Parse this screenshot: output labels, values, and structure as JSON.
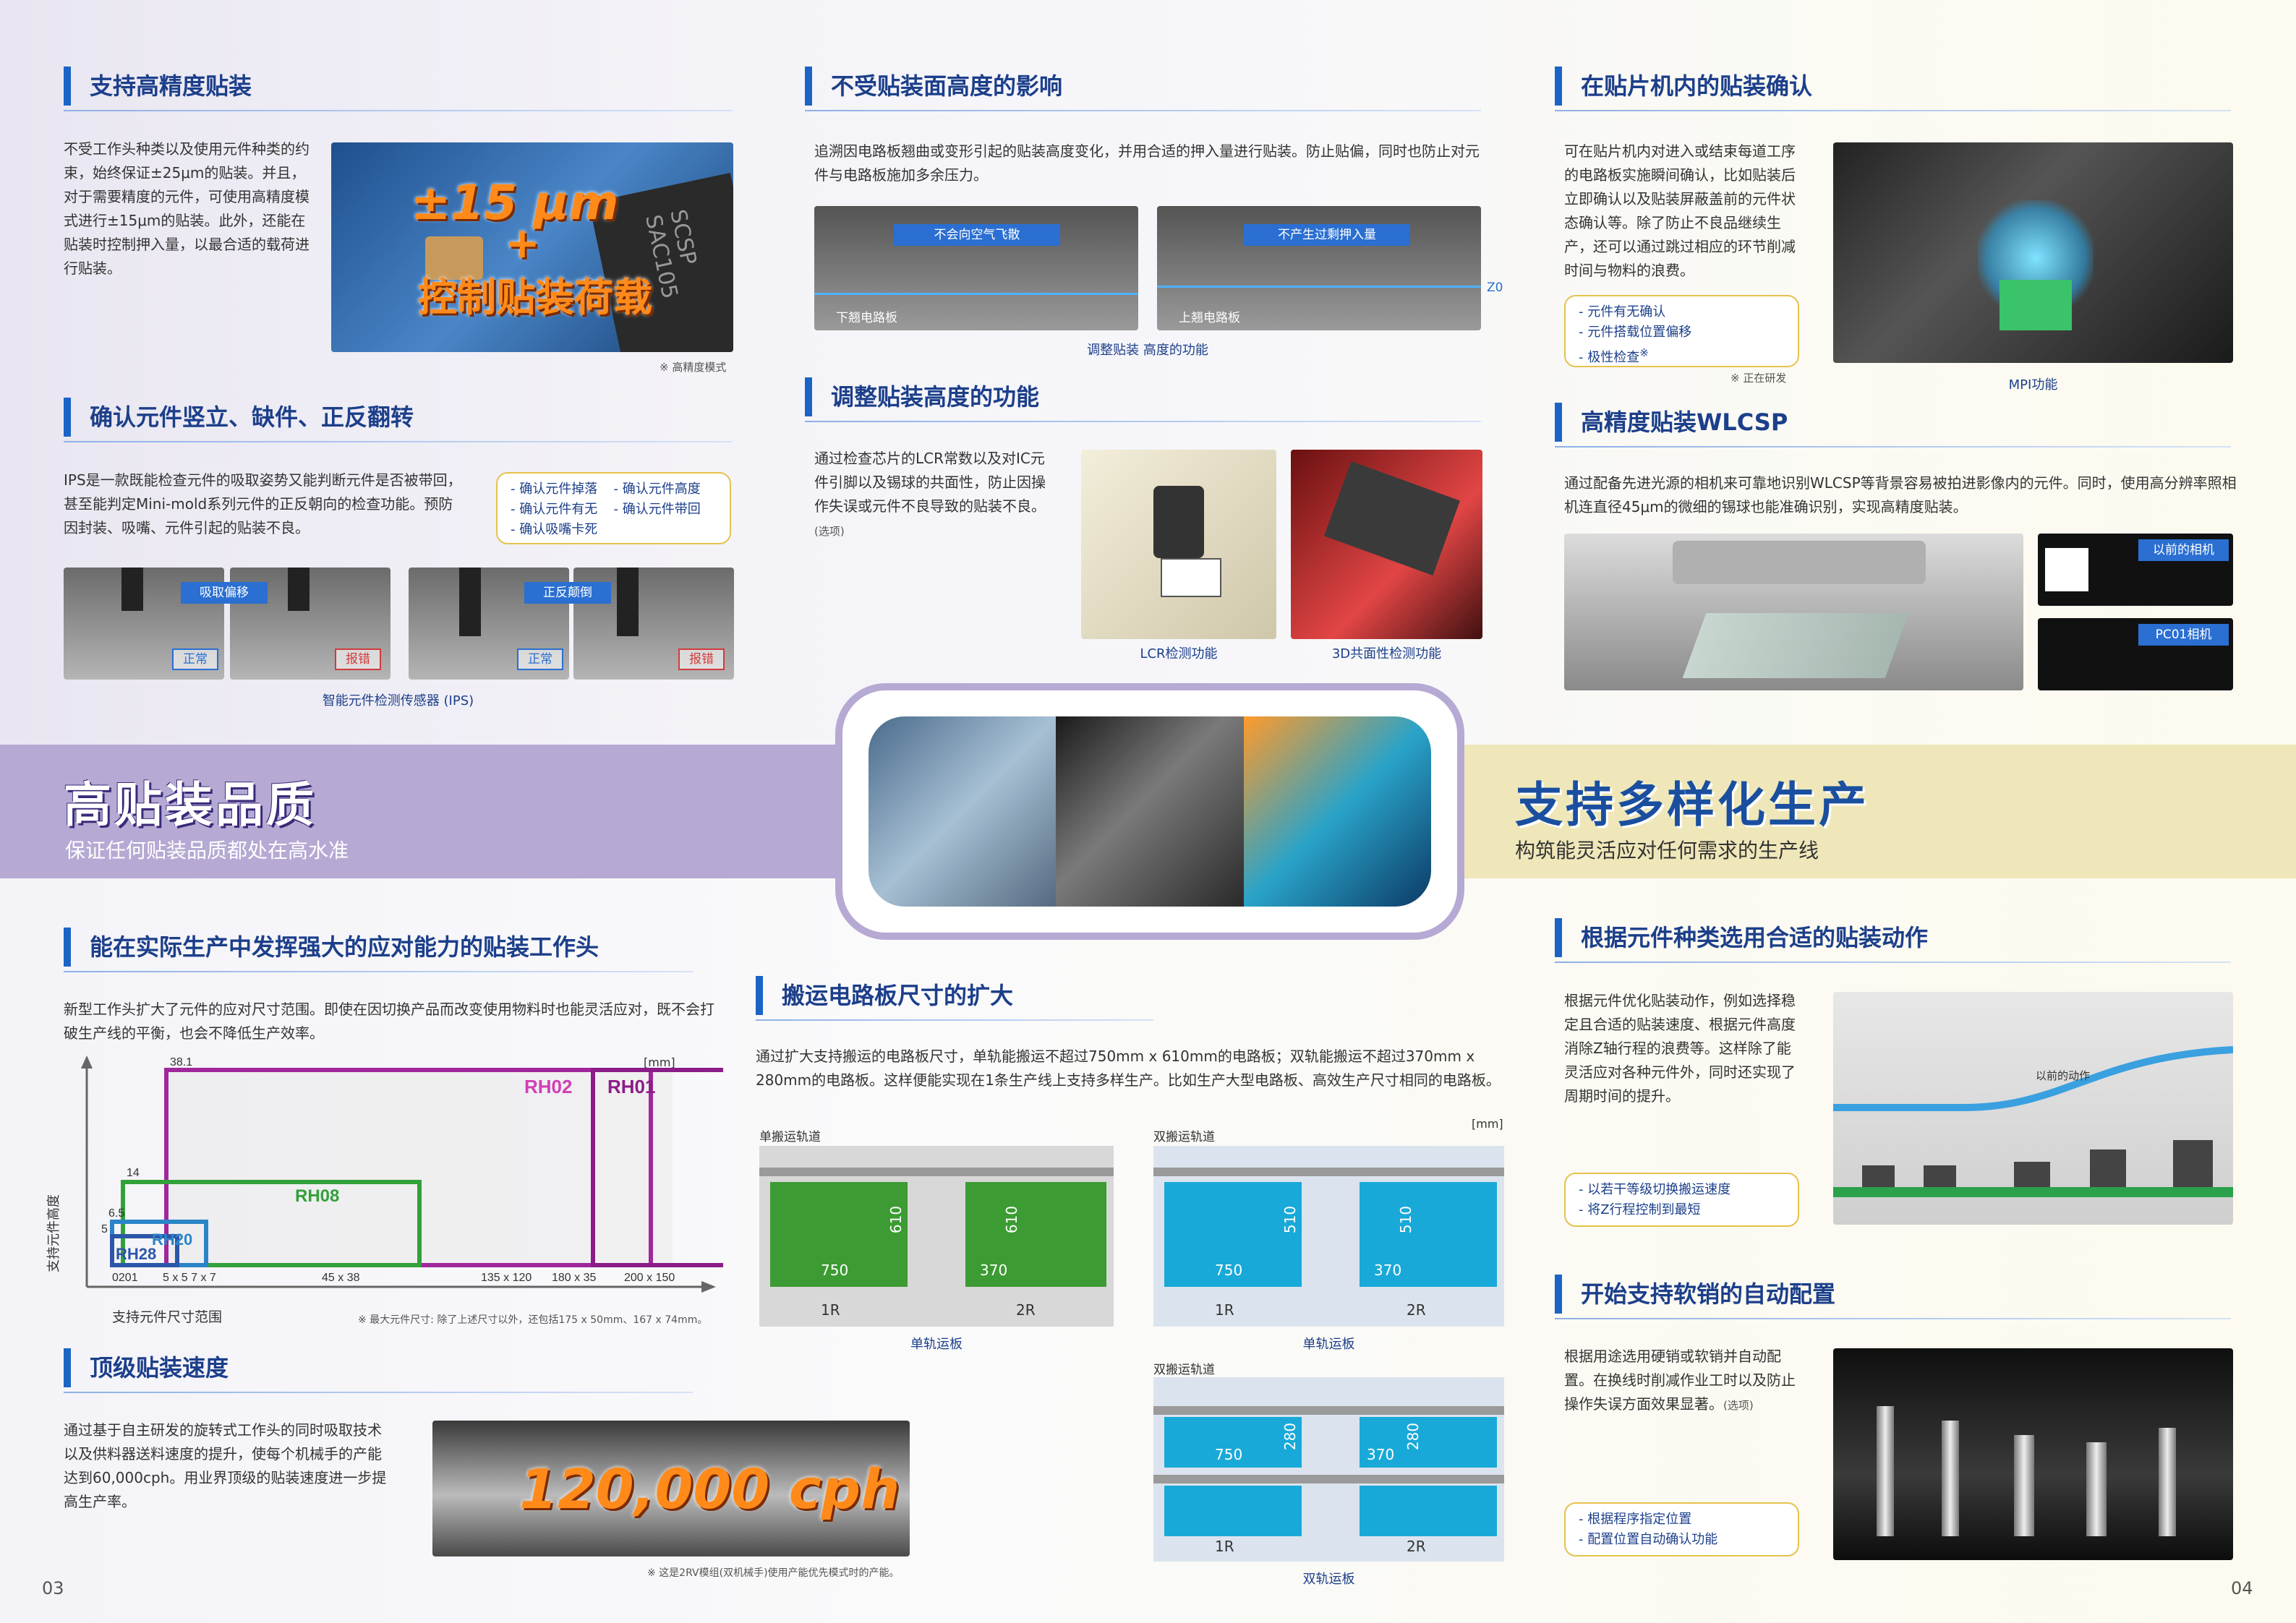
{
  "bands": {
    "left_title": "高贴装品质",
    "left_sub": "保证任何贴装品质都处在高水准",
    "right_title": "支持多样化生产",
    "right_sub": "构筑能灵活应对任何需求的生产线"
  },
  "s1": {
    "title": "支持高精度贴装",
    "body": "不受工作头种类以及使用元件种类的约束，始终保证±25μm的贴装。并且，对于需要精度的元件，可使用高精度模式进行±15μm的贴装。此外，还能在贴装时控制押入量，以最合适的载荷进行贴装。",
    "big1": "±15 μm",
    "plus": "+",
    "big2": "控制贴装荷载",
    "note": "※ 高精度模式",
    "chip_label": "SCSP SAC105"
  },
  "s2": {
    "title": "确认元件竖立、缺件、正反翻转",
    "body": "IPS是一款既能检查元件的吸取姿势又能判断元件是否被带回，甚至能判定Mini-mold系列元件的正反朝向的检查功能。预防因封装、吸嘴、元件引起的贴装不良。",
    "checks": [
      "- 确认元件掉落",
      "- 确认元件高度",
      "- 确认元件有无",
      "- 确认元件带回",
      "- 确认吸嘴卡死"
    ],
    "tag1": "吸取偏移",
    "tag2": "正反颠倒",
    "ok": "正常",
    "ng": "报错",
    "caption": "智能元件检测传感器 (IPS)"
  },
  "s3": {
    "title": "不受贴装面高度的影响",
    "body": "追溯因电路板翘曲或变形引起的贴装高度变化，并用合适的押入量进行贴装。防止贴偏，同时也防止对元件与电路板施加多余压力。",
    "tag1": "不会向空气飞散",
    "tag2": "不产生过剩押入量",
    "board1": "下翘电路板",
    "board2": "上翘电路板",
    "z0": "Z0",
    "caption": "调整贴装 高度的功能"
  },
  "s4": {
    "title": "调整贴装高度的功能",
    "body": "通过检查芯片的LCR常数以及对IC元件引脚以及锡球的共面性，防止因操作失误或元件不良导致的贴装不良。",
    "opt": "(选项)",
    "cap1": "LCR检测功能",
    "cap2": "3D共面性检测功能"
  },
  "s5": {
    "title": "在贴片机内的贴装确认",
    "body": "可在贴片机内对进入或结束每道工序的电路板实施瞬间确认，比如贴装后立即确认以及贴装屏蔽盖前的元件状态确认等。除了防止不良品继续生产，还可以通过跳过相应的环节削减时间与物料的浪费。",
    "checks": [
      "- 元件有无确认",
      "- 元件搭载位置偏移",
      "- 极性检查"
    ],
    "star": "※",
    "note": "※ 正在研发",
    "caption": "MPI功能"
  },
  "s6": {
    "title": "高精度贴装WLCSP",
    "body": "通过配备先进光源的相机来可靠地识别WLCSP等背景容易被拍进影像内的元件。同时，使用高分辨率照相机连直径45μm的微细的锡球也能准确识别，实现高精度贴装。",
    "tag1": "以前的相机",
    "tag2": "PC01相机"
  },
  "s7": {
    "title": "能在实际生产中发挥强大的应对能力的贴装工作头",
    "body": "新型工作头扩大了元件的应对尺寸范围。即使在因切换产品而改变使用物料时也能灵活应对，既不会打破生产线的平衡，也会不降低生产效率。",
    "unit": "[mm]",
    "ylabel": "支持元件高度",
    "xlabel": "支持元件尺寸范围",
    "note": "※ 最大元件尺寸: 除了上述尺寸以外，还包括175 x 50mm、167 x 74mm。"
  },
  "chart_data": {
    "type": "table",
    "title": "",
    "xlabel": "支持元件尺寸范围",
    "ylabel": "支持元件高度",
    "x_ticks": [
      "0201",
      "5 x 5 7 x 7",
      "45 x 38",
      "135 x 120",
      "180 x 35",
      "200 x 150"
    ],
    "y_ticks": [
      "38.1",
      "14",
      "6.5",
      "5"
    ],
    "heads": [
      {
        "name": "RH01",
        "max_size": "200 x 150",
        "max_height": 38.1
      },
      {
        "name": "RH02",
        "max_size": "180 x 35",
        "max_height": 38.1
      },
      {
        "name": "RH08",
        "max_size": "45 x 38",
        "max_height": 14
      },
      {
        "name": "RH20",
        "max_size": "7 x 7",
        "max_height": 6.5
      },
      {
        "name": "RH28",
        "max_size": "5 x 5",
        "max_height": 5
      }
    ]
  },
  "s8": {
    "title": "搬运电路板尺寸的扩大",
    "body": "通过扩大支持搬运的电路板尺寸，单轨能搬运不超过750mm x 610mm的电路板；双轨能搬运不超过370mm x 280mm的电路板。这样便能实现在1条生产线上支持多样生产。比如生产大型电路板、高效生产尺寸相同的电路板。",
    "unit": "[mm]",
    "single": "单搬运轨道",
    "dual": "双搬运轨道",
    "single_rail": "单轨运板",
    "dual_rail": "双轨运板",
    "r1": "1R",
    "r2": "2R",
    "dims": {
      "a": "750",
      "b": "610",
      "c": "370",
      "d": "510",
      "e": "280"
    }
  },
  "s9": {
    "title": "顶级贴装速度",
    "body": "通过基于自主研发的旋转式工作头的同时吸取技术以及供料器送料速度的提升，使每个机械手的产能达到60,000cph。用业界顶级的贴装速度进一步提高生产率。",
    "big": "120,000 cph",
    "note": "※ 这是2RV模组(双机械手)使用产能优先模式时的产能。"
  },
  "s10": {
    "title": "根据元件种类选用合适的贴装动作",
    "body": "根据元件优化贴装动作，例如选择稳定且合适的贴装速度、根据元件高度消除Z轴行程的浪费等。这样除了能灵活应对各种元件外，同时还实现了周期时间的提升。",
    "checks": [
      "- 以若干等级切换搬运速度",
      "- 将Z行程控制到最短"
    ],
    "label": "以前的动作"
  },
  "s11": {
    "title": "开始支持软销的自动配置",
    "body": "根据用途选用硬销或软销并自动配置。在换线时削减作业工时以及防止操作失误方面效果显著。",
    "opt": "(选项)",
    "checks": [
      "- 根据程序指定位置",
      "- 配置位置自动确认功能"
    ]
  },
  "pages": {
    "left": "03",
    "right": "04"
  },
  "colors": {
    "accent": "#1b64c5",
    "purple_band": "#b6a9d3",
    "yellow_band": "#efe7b9",
    "orange": "#ff8a1a"
  }
}
